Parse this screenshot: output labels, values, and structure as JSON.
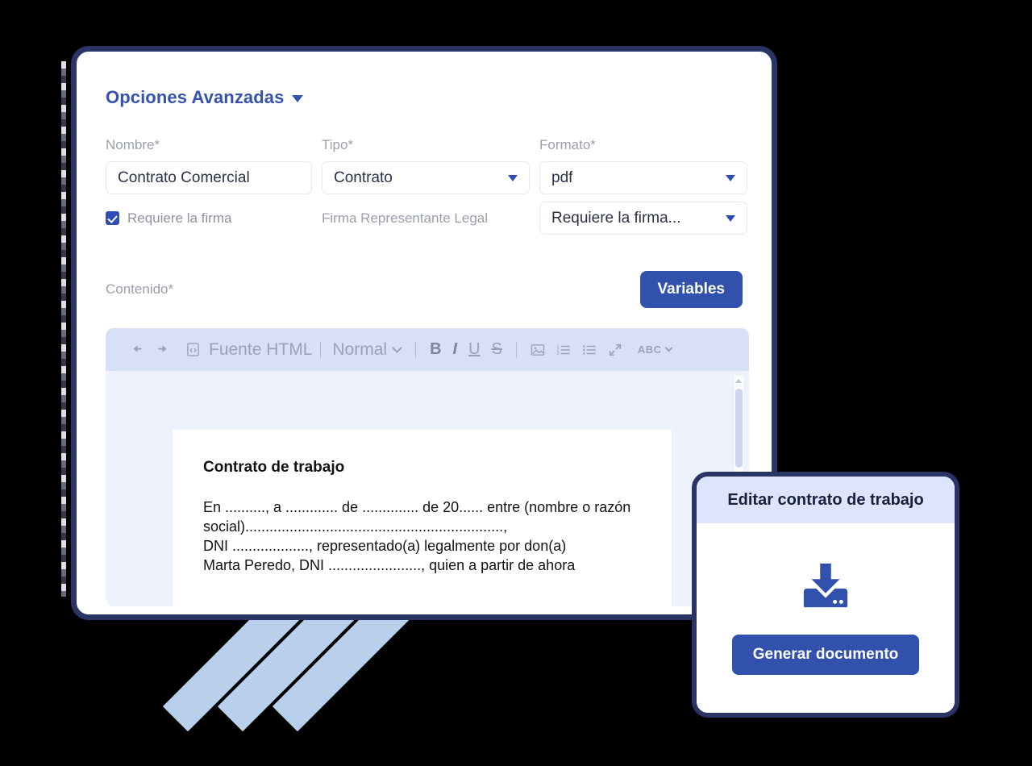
{
  "section": {
    "title": "Opciones Avanzadas",
    "caret_icon": "chevron-down-icon"
  },
  "form": {
    "nombre": {
      "label": "Nombre*",
      "value": "Contrato Comercial"
    },
    "tipo": {
      "label": "Tipo*",
      "value": "Contrato"
    },
    "formato": {
      "label": "Formato*",
      "value": "pdf"
    },
    "requiere_firma_checkbox": {
      "label": "Requiere la firma",
      "checked": true
    },
    "firma_representante": {
      "label": "Firma Representante Legal"
    },
    "firma_select": {
      "value": "Requiere la firma..."
    }
  },
  "contenido": {
    "label": "Contenido*",
    "variables_button": "Variables"
  },
  "toolbar": {
    "undo": "↩",
    "redo": "↪",
    "source_icon": "code-file-icon",
    "source_label": "Fuente HTML",
    "style_label": "Normal",
    "bold": "B",
    "italic": "I",
    "underline": "U",
    "strike": "S",
    "image_icon": "image-icon",
    "numbered_list_icon": "numbered-list-icon",
    "bullet_list_icon": "bullet-list-icon",
    "fullscreen_icon": "fullscreen-icon",
    "spellcheck_label": "ABC"
  },
  "document": {
    "title": "Contrato de trabajo",
    "body": "En .........., a ............. de .............. de 20...... entre (nombre o razón social)................................................................,\nDNI ..................., representado(a) legalmente por don(a)\nMarta Peredo, DNI ......................., quien a partir de ahora"
  },
  "card": {
    "title": "Editar contrato de trabajo",
    "download_icon": "download-icon",
    "button": "Generar documento"
  },
  "colors": {
    "window_border": "#2a3566",
    "accent_blue": "#3151ad",
    "heading_blue": "#3651b0",
    "toolbar_bg": "#d7e0f6",
    "editor_bg": "#eef2fc",
    "card_header_bg": "#dde5fa",
    "stripe_blue": "#b9d0ec",
    "page_bg": "#000000"
  }
}
